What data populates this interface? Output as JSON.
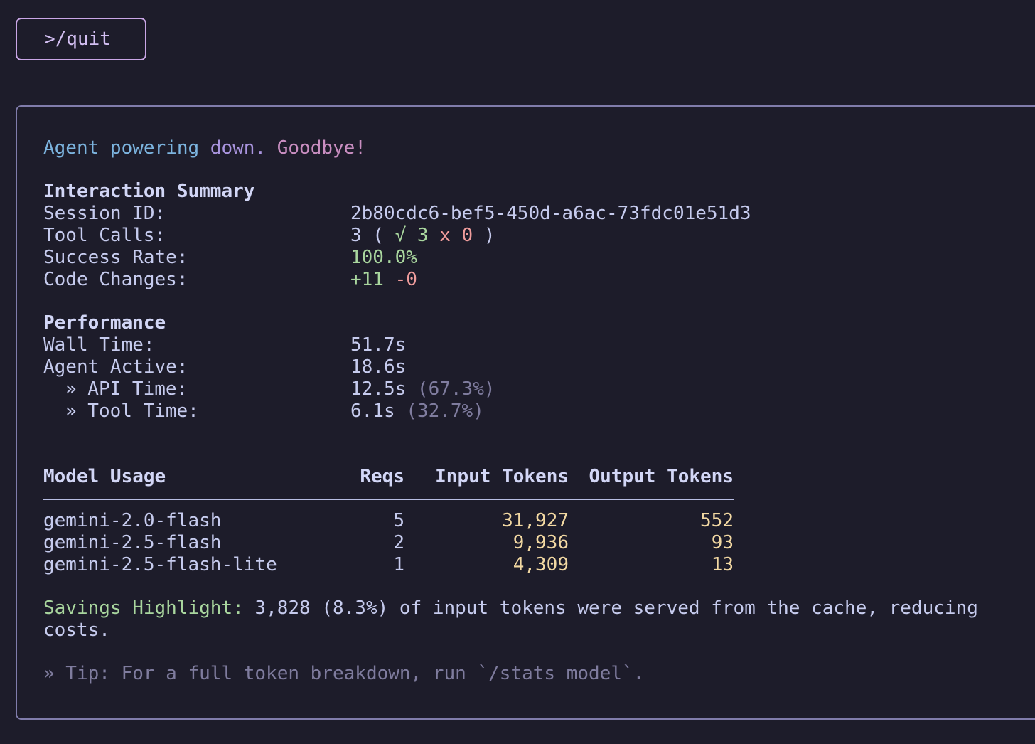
{
  "command": {
    "prompt": ">",
    "text": "/quit"
  },
  "goodbye": {
    "part1": "Agent powering",
    "part2": " down.",
    "part3": " Goodbye!"
  },
  "interaction_summary": {
    "heading": "Interaction Summary",
    "session_id_label": "Session ID:",
    "session_id_value": "2b80cdc6-bef5-450d-a6ac-73fdc01e51d3",
    "tool_calls_label": "Tool Calls:",
    "tool_calls_total": "3",
    "tool_calls_open": " ( ",
    "tool_calls_success": "√ 3",
    "tool_calls_fail": "x 0",
    "tool_calls_close": " )",
    "success_rate_label": "Success Rate:",
    "success_rate_value": "100.0%",
    "code_changes_label": "Code Changes:",
    "code_changes_added": "+11",
    "code_changes_removed": "-0"
  },
  "performance": {
    "heading": "Performance",
    "wall_time_label": "Wall Time:",
    "wall_time_value": "51.7s",
    "agent_active_label": "Agent Active:",
    "agent_active_value": "18.6s",
    "api_time_label": "» API Time:",
    "api_time_value": "12.5s",
    "api_time_pct": " (67.3%)",
    "tool_time_label": "» Tool Time:",
    "tool_time_value": "6.1s",
    "tool_time_pct": " (32.7%)"
  },
  "model_usage": {
    "headers": {
      "model": "Model Usage",
      "reqs": "Reqs",
      "input": "Input Tokens",
      "output": "Output Tokens"
    },
    "rows": [
      {
        "model": "gemini-2.0-flash",
        "reqs": "5",
        "input": "31,927",
        "output": "552"
      },
      {
        "model": "gemini-2.5-flash",
        "reqs": "2",
        "input": "9,936",
        "output": "93"
      },
      {
        "model": "gemini-2.5-flash-lite",
        "reqs": "1",
        "input": "4,309",
        "output": "13"
      }
    ]
  },
  "savings": {
    "label": "Savings Highlight:",
    "text_line1": " 3,828 (8.3%) of input tokens were served from the cache, reducing",
    "text_line2": "costs."
  },
  "tip": {
    "text": "» Tip: For a full token breakdown, run `/stats model`."
  }
}
